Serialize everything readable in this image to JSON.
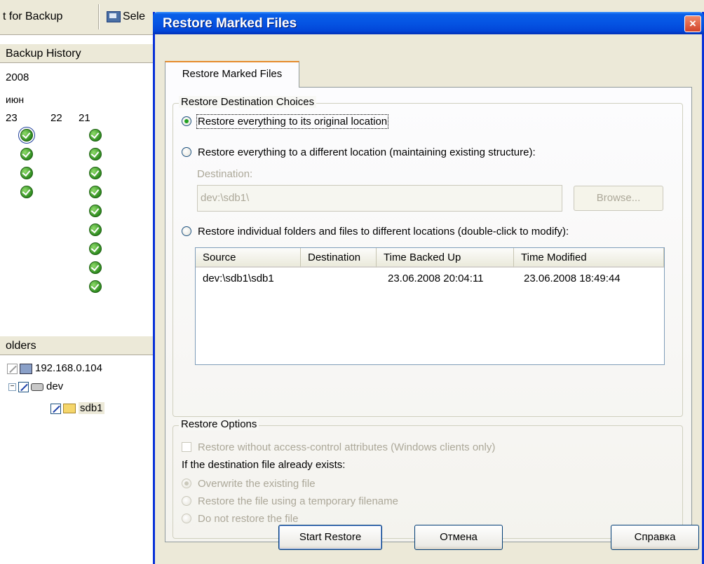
{
  "background_app": {
    "toolbar": {
      "select_for_backup_label": "t for Backup",
      "select_label": "Sele"
    },
    "history_pane": {
      "header": "Backup History",
      "year": "2008",
      "month": "июн",
      "days": [
        "23",
        "22",
        "21"
      ]
    },
    "folders_pane": {
      "header": "olders",
      "tree": [
        {
          "label": "192.168.0.104",
          "icon": "computer-icon"
        },
        {
          "label": "dev",
          "icon": "drive-icon"
        },
        {
          "label": "sdb1",
          "icon": "folder-icon"
        }
      ]
    }
  },
  "dialog": {
    "title": "Restore Marked Files",
    "close_label": "×",
    "tab_label": "Restore Marked Files",
    "destination_group": {
      "legend": "Restore Destination Choices",
      "option_original": "Restore everything to its original location",
      "option_different": "Restore everything to a different location (maintaining existing structure):",
      "destination_label": "Destination:",
      "destination_value": "dev:\\sdb1\\",
      "browse_label": "Browse...",
      "option_individual": "Restore individual folders and files to different locations (double-click to modify):",
      "selected_option": "original"
    },
    "file_list": {
      "columns": [
        "Source",
        "Destination",
        "Time Backed Up",
        "Time Modified"
      ],
      "rows": [
        {
          "source": "dev:\\sdb1\\sdb1",
          "destination": "",
          "time_backed_up": "23.06.2008 20:04:11",
          "time_modified": "23.06.2008 18:49:44"
        }
      ]
    },
    "options_group": {
      "legend": "Restore Options",
      "no_acl_label": "Restore without access-control attributes (Windows clients only)",
      "exists_label": "If the destination file already exists:",
      "overwrite_label": "Overwrite the existing file",
      "temp_name_label": "Restore the file using a temporary filename",
      "do_not_restore_label": "Do not restore the file"
    },
    "buttons": {
      "start_restore": "Start Restore",
      "cancel": "Отмена",
      "help": "Справка"
    }
  },
  "colors": {
    "titlebar": "#0554e3",
    "face": "#ece9d8",
    "close": "#d1432a"
  }
}
